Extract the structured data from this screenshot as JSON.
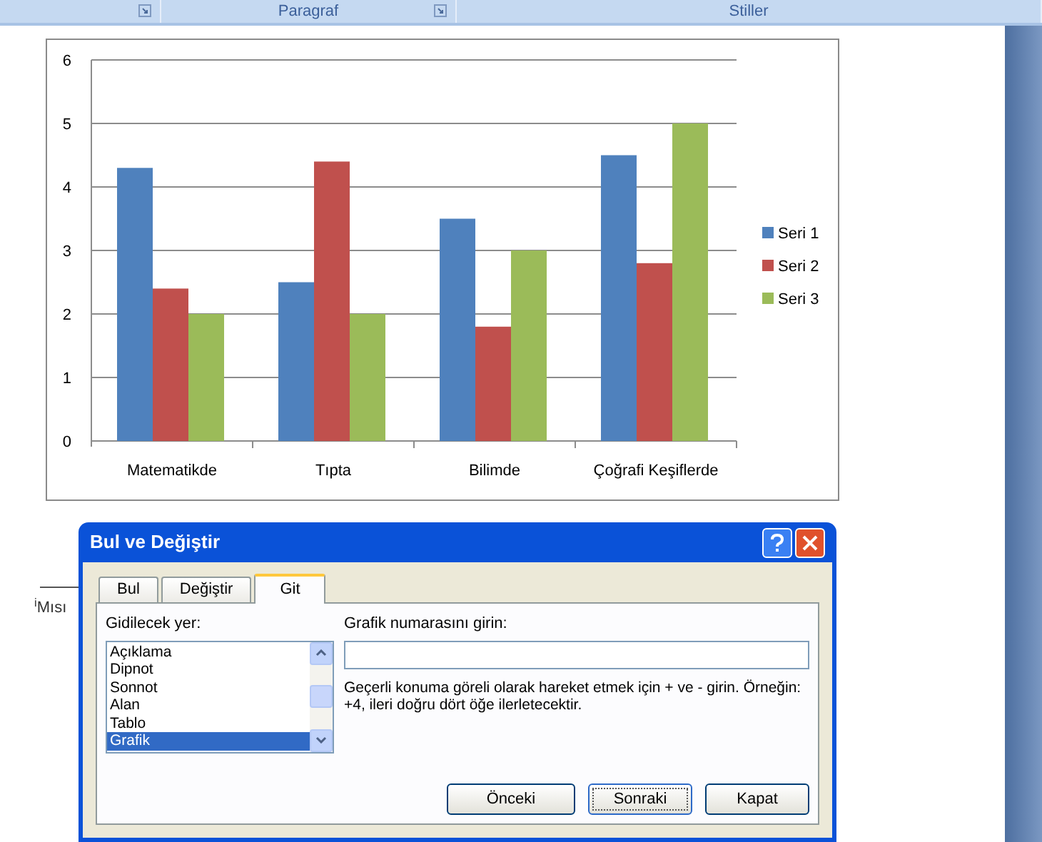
{
  "ribbon": {
    "groups": [
      {
        "launcher": true
      },
      {
        "label": "Paragraf",
        "launcher": true
      },
      {
        "label": "Stiller"
      }
    ]
  },
  "chart": {
    "chart_data": {
      "type": "bar",
      "categories": [
        "Matematikde",
        "Tıpta",
        "Bilimde",
        "Çoğrafi Keşiflerde"
      ],
      "series": [
        {
          "name": "Seri 1",
          "color": "#4f81bd",
          "values": [
            4.3,
            2.5,
            3.5,
            4.5
          ]
        },
        {
          "name": "Seri 2",
          "color": "#c0504d",
          "values": [
            2.4,
            4.4,
            1.8,
            2.8
          ]
        },
        {
          "name": "Seri 3",
          "color": "#9bbb59",
          "values": [
            2,
            2,
            3,
            5
          ]
        }
      ],
      "grid": true,
      "legend": true,
      "ylim": [
        0,
        6
      ],
      "yticks": [
        0,
        1,
        2,
        3,
        4,
        5,
        6
      ]
    }
  },
  "footnote": {
    "text": "$^{i}$Mısı"
  },
  "dialog": {
    "title": "Bul ve Değiştir",
    "tabs": [
      {
        "label": "Bul",
        "selected": false
      },
      {
        "label": "Değiştir",
        "selected": false
      },
      {
        "label": "Git",
        "selected": true
      }
    ],
    "target_label": "Gidilecek yer:",
    "targets": [
      {
        "label": "Açıklama",
        "selected": false
      },
      {
        "label": "Dipnot",
        "selected": false
      },
      {
        "label": "Sonnot",
        "selected": false
      },
      {
        "label": "Alan",
        "selected": false
      },
      {
        "label": "Tablo",
        "selected": false
      },
      {
        "label": "Grafik",
        "selected": true
      }
    ],
    "number_label": "Grafik numarasını girin:",
    "hint": "Geçerli konuma göreli olarak hareket etmek için + ve - girin. Örneğin: +4, ileri doğru dört öğe ilerletecektir.",
    "buttons": [
      {
        "label": "Önceki",
        "default": false
      },
      {
        "label": "Sonraki",
        "default": true
      },
      {
        "label": "Kapat",
        "default": false
      }
    ]
  }
}
